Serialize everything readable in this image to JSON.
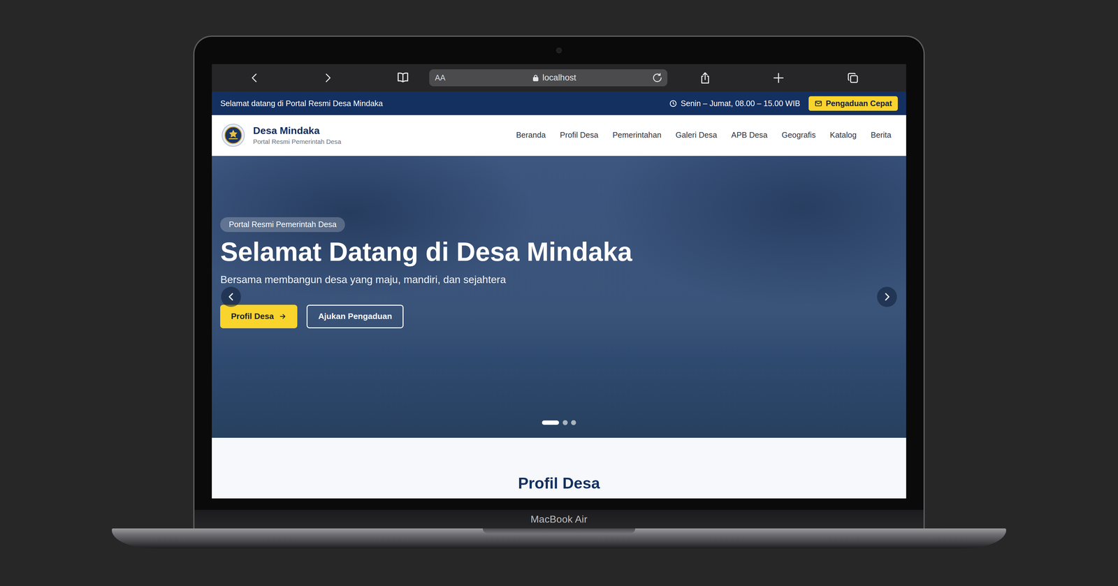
{
  "device": {
    "label": "MacBook Air"
  },
  "browser": {
    "text_size": "AA",
    "address": "localhost"
  },
  "topbar": {
    "welcome": "Selamat datang di Portal Resmi Desa Mindaka",
    "hours": "Senin – Jumat, 08.00 – 15.00 WIB",
    "complaint_button": "Pengaduan Cepat"
  },
  "site": {
    "name": "Desa Mindaka",
    "tagline": "Portal Resmi Pemerintah Desa"
  },
  "nav": [
    {
      "label": "Beranda",
      "selected": false
    },
    {
      "label": "Profil Desa",
      "selected": false
    },
    {
      "label": "Pemerintahan",
      "selected": false
    },
    {
      "label": "Galeri Desa",
      "selected": false
    },
    {
      "label": "APB Desa",
      "selected": false
    },
    {
      "label": "Geografis",
      "selected": false
    },
    {
      "label": "Katalog",
      "selected": false
    },
    {
      "label": "Berita",
      "selected": false
    }
  ],
  "hero": {
    "badge": "Portal Resmi Pemerintah Desa",
    "title": "Selamat Datang di Desa Mindaka",
    "subtitle": "Bersama membangun desa yang maju, mandiri, dan sejahtera",
    "buttons": [
      {
        "label": "Profil Desa",
        "kind": "primary"
      },
      {
        "label": "Ajukan Pengaduan",
        "kind": "outline"
      }
    ],
    "slides": [
      {
        "selected": true
      },
      {
        "selected": false
      },
      {
        "selected": false
      }
    ]
  },
  "section": {
    "title": "Profil Desa"
  }
}
